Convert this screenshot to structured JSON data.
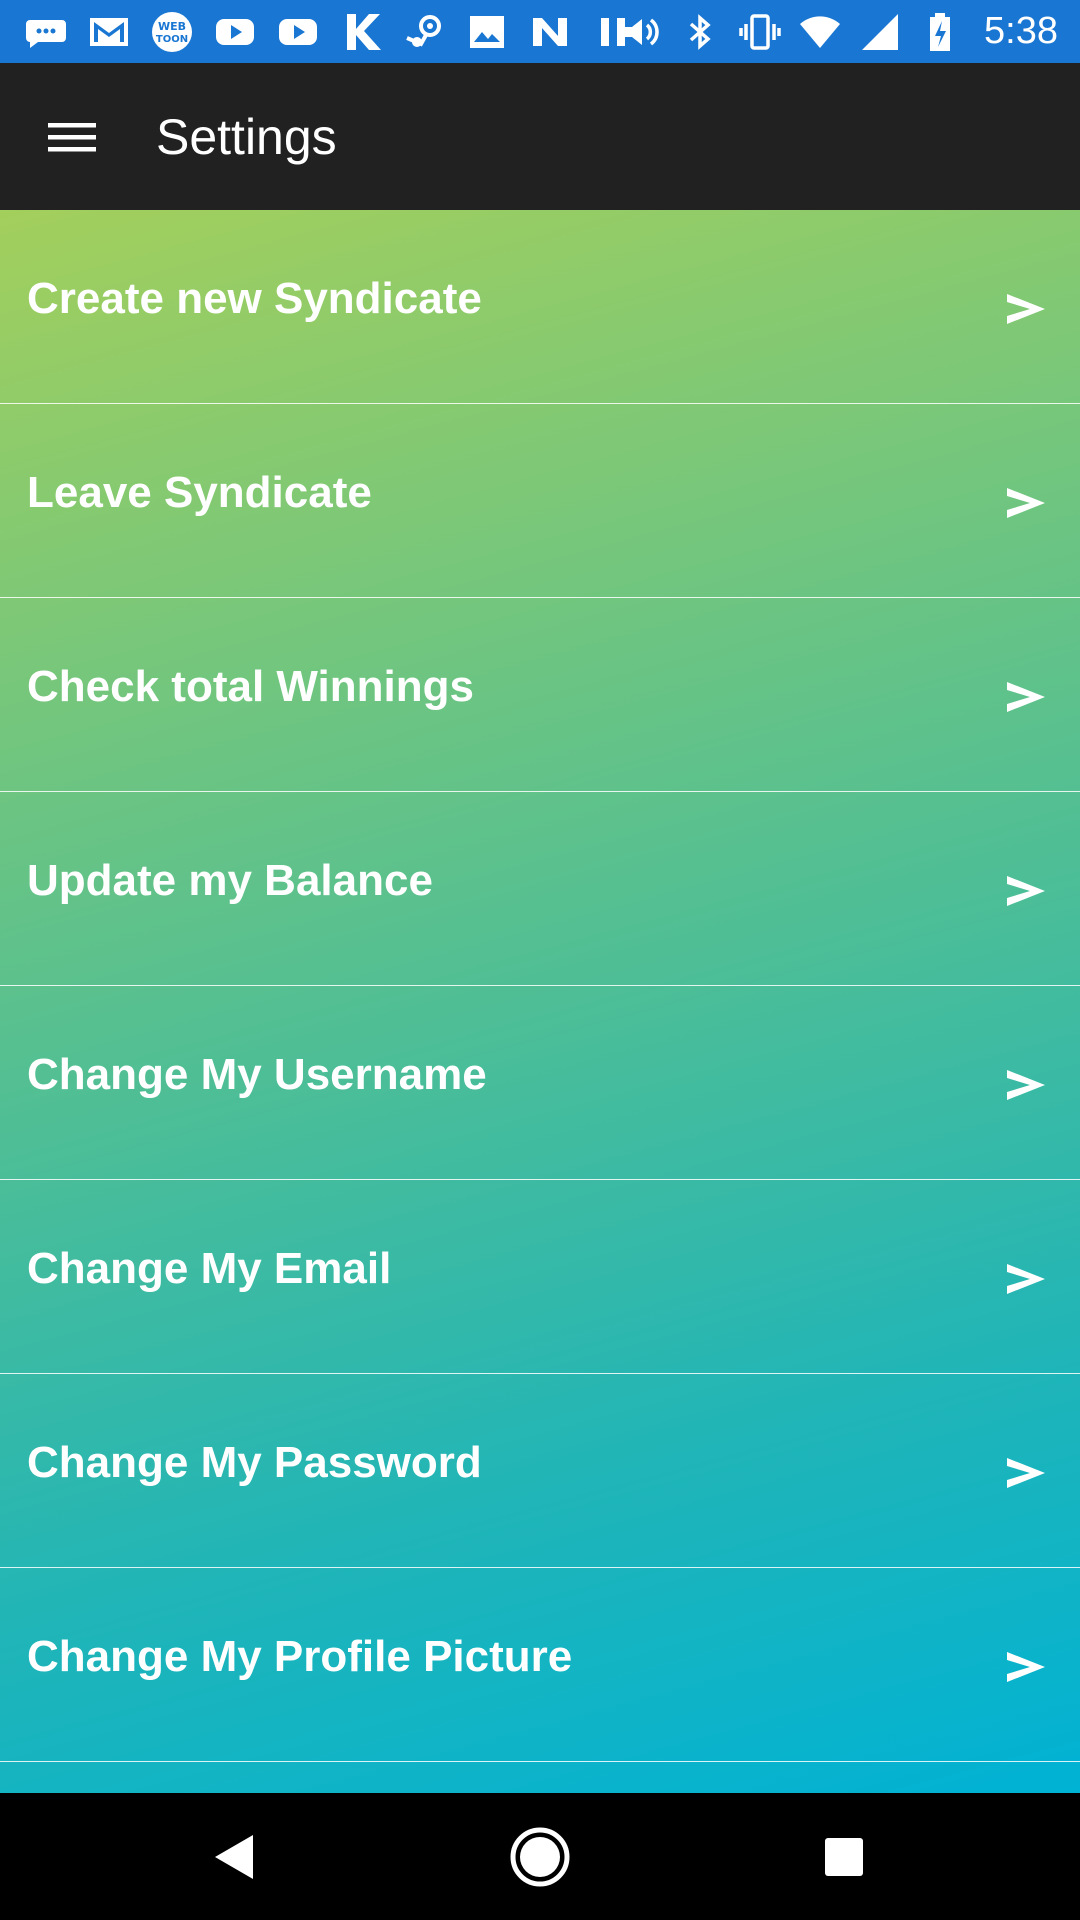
{
  "status_bar": {
    "time": "5:38",
    "notification_icons": [
      "chat-icon",
      "gmail-icon",
      "webtoon-icon",
      "youtube-icon",
      "youtube-icon",
      "k-app-icon",
      "steam-icon",
      "image-icon",
      "n-app-icon",
      "pause-icon"
    ],
    "system_icons": [
      "volume-icon",
      "bluetooth-icon",
      "vibrate-icon",
      "wifi-icon",
      "signal-icon",
      "battery-charging-icon"
    ],
    "background_color": "#1976d2"
  },
  "app_bar": {
    "title": "Settings",
    "menu_icon": "hamburger-menu-icon",
    "background_color": "#212121"
  },
  "settings": {
    "items": [
      {
        "label": "Create new Syndicate",
        "chevron": ">"
      },
      {
        "label": "Leave Syndicate",
        "chevron": ">"
      },
      {
        "label": "Check total Winnings",
        "chevron": ">"
      },
      {
        "label": "Update my Balance",
        "chevron": ">"
      },
      {
        "label": "Change My Username",
        "chevron": ">"
      },
      {
        "label": "Change My Email",
        "chevron": ">"
      },
      {
        "label": "Change My Password",
        "chevron": ">"
      },
      {
        "label": "Change My Profile Picture",
        "chevron": ">"
      }
    ],
    "gradient_colors": [
      "#a3cf5c",
      "#00b2d4"
    ]
  },
  "nav_bar": {
    "buttons": [
      "back-icon",
      "home-icon",
      "recents-icon"
    ]
  }
}
